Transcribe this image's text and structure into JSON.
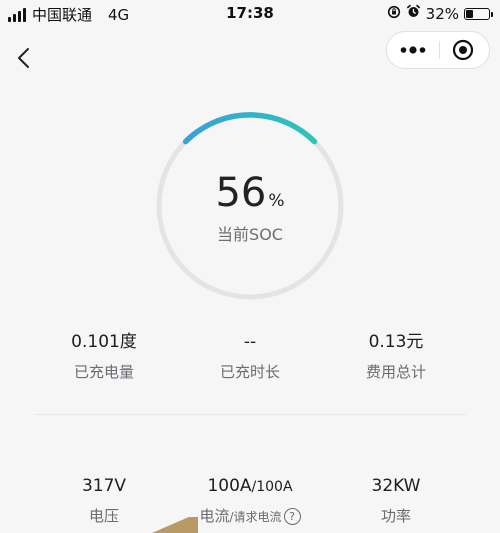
{
  "status_bar": {
    "carrier": "中国联通",
    "network": "4G",
    "time": "17:38",
    "battery_percent": "32%",
    "battery_level": 0.32
  },
  "nav": {
    "back_icon": "chevron-left-icon",
    "more_icon": "more-dots-icon",
    "close_icon": "target-close-icon"
  },
  "gauge": {
    "value": "56",
    "unit": "%",
    "label": "当前SOC",
    "arc_color_start": "#3aa0d8",
    "arc_color_end": "#2ec4b6",
    "track_color": "#e3e3e8"
  },
  "charge_stats": [
    {
      "value": "0.101度",
      "label": "已充电量"
    },
    {
      "value": "--",
      "label": "已充时长"
    },
    {
      "value": "0.13元",
      "label": "费用总计"
    }
  ],
  "electric_stats": {
    "voltage": {
      "value": "317V",
      "label": "电压"
    },
    "current": {
      "value": "100A",
      "requested_value": "100A",
      "label": "电流",
      "requested_label": "请求电流",
      "help_icon": "question-circle-icon"
    },
    "power": {
      "value": "32KW",
      "label": "功率"
    }
  }
}
